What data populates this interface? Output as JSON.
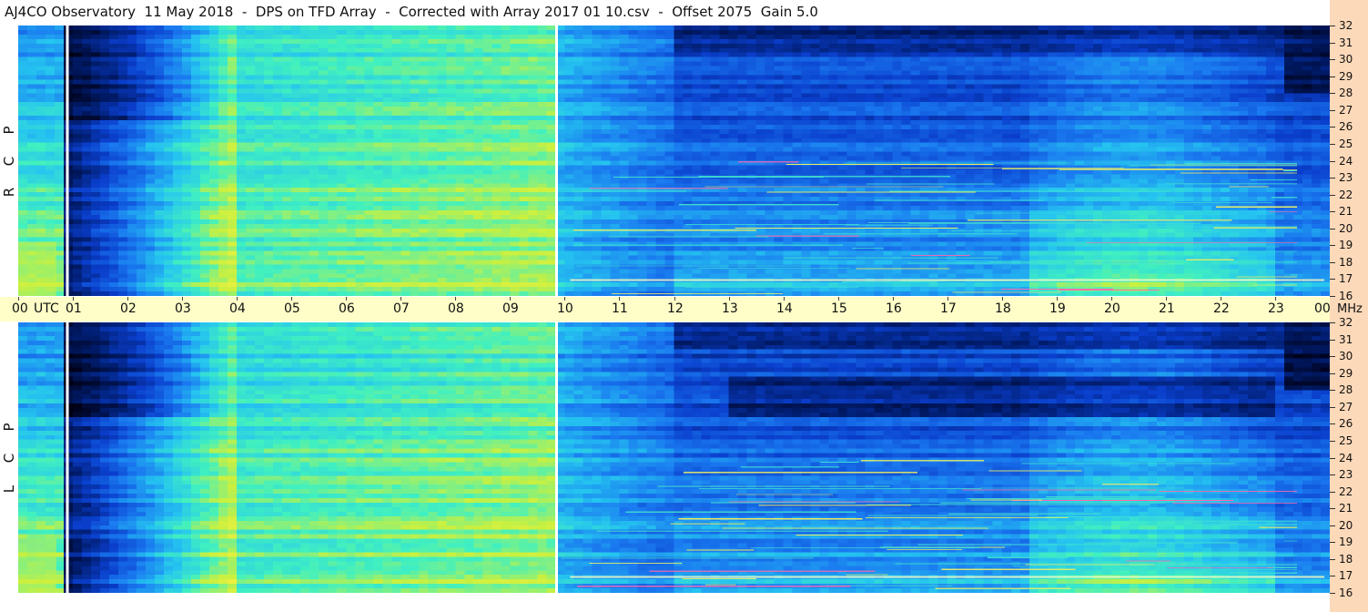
{
  "title": "AJ4CO Observatory  11 May 2018  -  DPS on TFD Array  -  Corrected with Array 2017 01 10.csv  -  Offset 2075  Gain 5.0",
  "chart_data": {
    "type": "heatmap",
    "title": "AJ4CO Observatory  11 May 2018  -  DPS on TFD Array  -  Corrected with Array 2017 01 10.csv  -  Offset 2075  Gain 5.0",
    "xlabel": "UTC",
    "ylabel": "MHz",
    "xlim": [
      0,
      24
    ],
    "ylim": [
      16,
      32
    ],
    "x_ticks": [
      "00",
      "01",
      "02",
      "03",
      "04",
      "05",
      "06",
      "07",
      "08",
      "09",
      "10",
      "11",
      "12",
      "13",
      "14",
      "15",
      "16",
      "17",
      "18",
      "19",
      "20",
      "21",
      "22",
      "23",
      "00"
    ],
    "y_ticks": [
      "32",
      "31",
      "30",
      "29",
      "28",
      "27",
      "26",
      "25",
      "24",
      "23",
      "22",
      "21",
      "20",
      "19",
      "18",
      "17",
      "16"
    ],
    "panels": [
      {
        "name": "RCP",
        "letters": [
          "P",
          "C",
          "R"
        ]
      },
      {
        "name": "LCP",
        "letters": [
          "P",
          "C",
          "L"
        ]
      }
    ],
    "gaps_utc": [
      0.9,
      9.85
    ],
    "colormap": [
      "#000014",
      "#001a66",
      "#0a3ecc",
      "#1a7af0",
      "#25c4f0",
      "#40f0c0",
      "#c8f040",
      "#f0f040",
      "#f06080",
      "#ffffff"
    ]
  },
  "axis": {
    "utc_label": "UTC",
    "mhz_label": "MHz"
  },
  "colors": {
    "time_axis_bg": "#fffec8",
    "freq_axis_bg": "#fcd9b9"
  }
}
